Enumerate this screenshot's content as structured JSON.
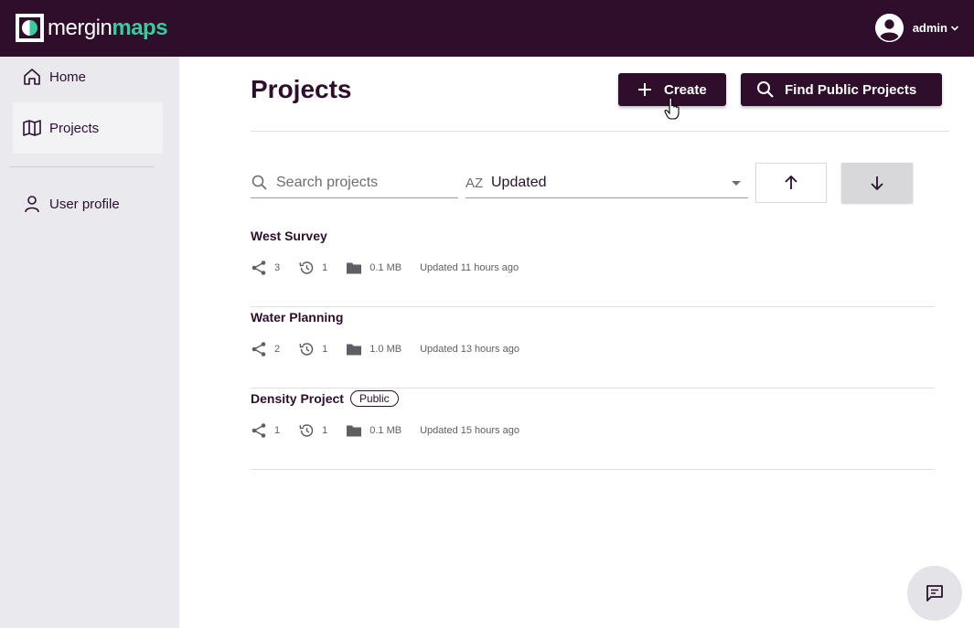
{
  "header": {
    "logo_merg": "mergin",
    "logo_maps": "maps",
    "user_name": "admin",
    "colors": {
      "bar": "#2e0e2b",
      "brand_green": "#3acb9c"
    }
  },
  "sidebar": {
    "items": [
      {
        "label": "Home",
        "icon": "home-icon",
        "active": false
      },
      {
        "label": "Projects",
        "icon": "map-icon",
        "active": true
      },
      {
        "label": "User profile",
        "icon": "user-icon",
        "active": false
      }
    ]
  },
  "main": {
    "title": "Projects",
    "create_label": "Create",
    "find_label": "Find Public Projects",
    "search_placeholder": "Search projects",
    "sort_icon_text": "AZ",
    "sort_value": "Updated",
    "sort_direction": "descending"
  },
  "projects": [
    {
      "name": "West Survey",
      "badge": "",
      "shares": "3",
      "versions": "1",
      "size": "0.1 MB",
      "updated": "Updated 11 hours ago"
    },
    {
      "name": "Water Planning",
      "badge": "",
      "shares": "2",
      "versions": "1",
      "size": "1.0 MB",
      "updated": "Updated 13 hours ago"
    },
    {
      "name": "Density Project",
      "badge": "Public",
      "shares": "1",
      "versions": "1",
      "size": "0.1 MB",
      "updated": "Updated 15 hours ago"
    }
  ]
}
